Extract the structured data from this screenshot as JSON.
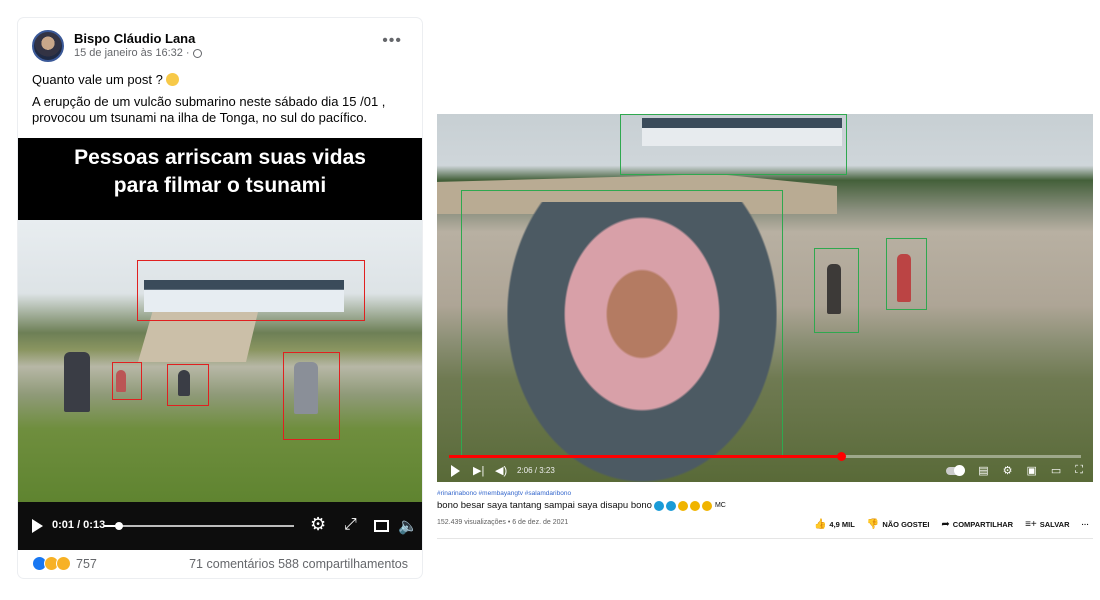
{
  "facebook": {
    "author": "Bispo Cláudio Lana",
    "date": "15 de janeiro às 16:32 ·",
    "post_line1": "Quanto vale um post ?",
    "post_line2": "A erupção de um vulcão submarino neste sábado dia 15 /01 , provocou um tsunami na ilha de Tonga, no sul do pacífico.",
    "video_caption_line1": "Pessoas arriscam suas vidas",
    "video_caption_line2": "para filmar o tsunami",
    "time": "0:01 / 0:13",
    "progress": 0.077,
    "reaction_count": "757",
    "comments": "71 comentários",
    "shares": "588 compartilhamentos",
    "icons": [
      "globe-icon",
      "more-icon",
      "play-icon",
      "gear-icon",
      "expand-icon",
      "pip-icon",
      "mute-icon"
    ]
  },
  "youtube": {
    "time": "2:06 / 3:23",
    "progress": 0.62,
    "tags": "#rinarinabono #membayangtv #salamdaribono",
    "title": "bono besar saya tantang sampai saya disapu bono",
    "title_suffix": "MC",
    "views": "152.439 visualizações • 6 de dez. de 2021",
    "likes": "4,9 MIL",
    "dislike_label": "NÃO GOSTEI",
    "share_label": "COMPARTILHAR",
    "save_label": "SALVAR",
    "more": "···",
    "icons": [
      "play-icon",
      "next-icon",
      "volume-icon",
      "autoplay-toggle-icon",
      "subtitles-icon",
      "settings-icon",
      "miniplayer-icon",
      "theater-icon",
      "fullscreen-icon"
    ]
  },
  "colors": {
    "facebook_blue": "#1877f2",
    "highlight_red": "#e02020",
    "highlight_green": "#2fa84f",
    "youtube_red": "#ff0000"
  }
}
